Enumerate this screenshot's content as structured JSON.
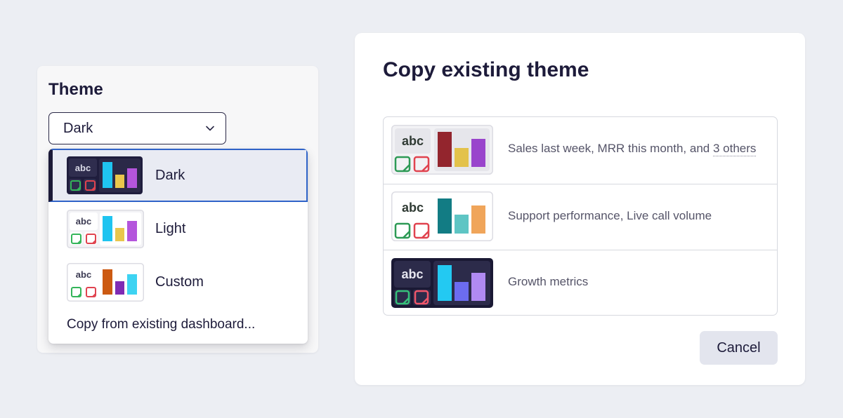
{
  "theme_panel": {
    "title": "Theme",
    "select_value": "Dark",
    "options": [
      {
        "label": "Dark"
      },
      {
        "label": "Light"
      },
      {
        "label": "Custom"
      }
    ],
    "copy_option": "Copy from existing dashboard..."
  },
  "thumb_text": "abc",
  "modal": {
    "title": "Copy existing theme",
    "rows": [
      {
        "desc_prefix": "Sales last week, MRR this month, and ",
        "desc_link": "3 others"
      },
      {
        "desc": "Support performance, Live call volume"
      },
      {
        "desc": "Growth metrics"
      }
    ],
    "cancel_label": "Cancel"
  },
  "colors": {
    "dark_bg": "#1f1d3d",
    "selected_border": "#2f63c8",
    "dark_bars": [
      "#1fc4f0",
      "#e9c64c",
      "#b455dc"
    ],
    "light_bars": [
      "#1fc4f0",
      "#e9c64c",
      "#b455dc"
    ],
    "custom_bars": [
      "#cc5a12",
      "#7f2bb4",
      "#3dd3f2"
    ],
    "sales_bars": [
      "#93252d",
      "#e3c24b",
      "#9944cc"
    ],
    "support_bars": [
      "#127c84",
      "#5ec5c4",
      "#f0a55a"
    ],
    "growth_bars": [
      "#23c9f2",
      "#6c6cf0",
      "#b08af2"
    ]
  }
}
